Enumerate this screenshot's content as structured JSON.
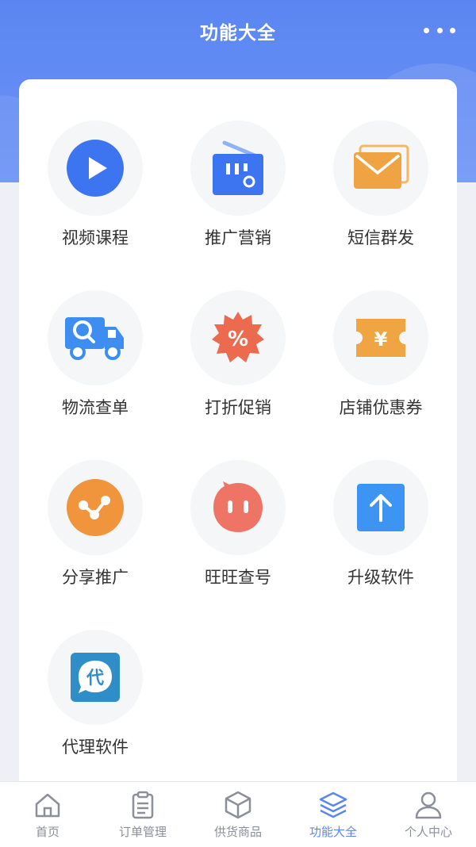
{
  "header": {
    "title": "功能大全",
    "more_icon": "more-dots-icon"
  },
  "features": [
    {
      "label": "视频课程",
      "icon": "play-icon",
      "color": "#3d74f0"
    },
    {
      "label": "推广营销",
      "icon": "radio-icon",
      "color": "#3d74f0"
    },
    {
      "label": "短信群发",
      "icon": "envelope-icon",
      "color": "#efa343"
    },
    {
      "label": "物流查单",
      "icon": "truck-search-icon",
      "color": "#3d8ef0"
    },
    {
      "label": "打折促销",
      "icon": "percent-badge-icon",
      "color": "#ec6a4e"
    },
    {
      "label": "店铺优惠券",
      "icon": "yuan-coupon-icon",
      "color": "#f0a543"
    },
    {
      "label": "分享推广",
      "icon": "share-icon",
      "color": "#f0953c"
    },
    {
      "label": "旺旺查号",
      "icon": "chat-face-icon",
      "color": "#ee7565"
    },
    {
      "label": "升级软件",
      "icon": "upgrade-arrow-icon",
      "color": "#3d94f2"
    },
    {
      "label": "代理软件",
      "icon": "agent-icon",
      "color": "#2f8ec8"
    }
  ],
  "tabbar": {
    "active_color": "#5b86f2",
    "tabs": [
      {
        "label": "首页",
        "icon": "home-icon"
      },
      {
        "label": "订单管理",
        "icon": "clipboard-icon"
      },
      {
        "label": "供货商品",
        "icon": "box-icon"
      },
      {
        "label": "功能大全",
        "icon": "layers-icon",
        "active": true
      },
      {
        "label": "个人中心",
        "icon": "user-icon"
      }
    ]
  }
}
